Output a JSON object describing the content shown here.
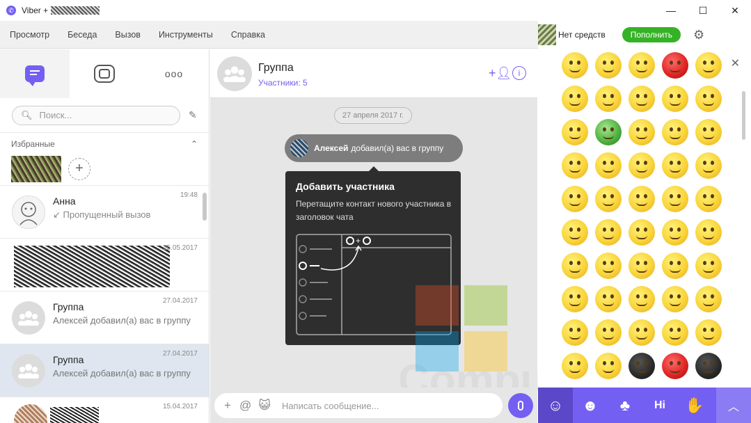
{
  "window": {
    "title": "Viber +",
    "controls": {
      "minimize": "—",
      "maximize": "☐",
      "close": "✕"
    }
  },
  "menu": {
    "items": [
      "Просмотр",
      "Беседа",
      "Вызов",
      "Инструменты",
      "Справка"
    ],
    "balance": "Нет средств",
    "topup_label": "Пополнить",
    "settings_icon": "gear-icon"
  },
  "left": {
    "search_placeholder": "Поиск...",
    "favorites_label": "Избранные",
    "chats": [
      {
        "name": "Анна",
        "message": "↙ Пропущенный вызов",
        "time": "19:48"
      },
      {
        "name": "",
        "message": "",
        "time": "25.05.2017"
      },
      {
        "name": "Группа",
        "message": "Алексей добавил(а) вас в группу",
        "time": "27.04.2017"
      },
      {
        "name": "Группа",
        "message": "Алексей добавил(а) вас в группу",
        "time": "27.04.2017"
      },
      {
        "name": "",
        "message": "",
        "time": "15.04.2017"
      }
    ]
  },
  "conversation": {
    "name": "Группа",
    "subtitle": "Участники: 5",
    "date": "27 апреля 2017 г.",
    "system_actor": "Алексей",
    "system_text": "добавил(а) вас в группу",
    "tip_title": "Добавить участника",
    "tip_text": "Перетащите контакт нового участника в заголовок чата",
    "input_placeholder": "Написать сообщение..."
  },
  "emoji_panel": {
    "close": "✕",
    "tabs": [
      "smiley-icon",
      "character-icon",
      "creature-icon",
      "hi-icon",
      "hand-icon",
      "collapse-icon"
    ],
    "hi_label": "Hi"
  },
  "watermark": "Computer-Setup.Ru",
  "colors": {
    "accent": "#7360f2",
    "topup": "#36b226",
    "selected_row": "#dfe6ef"
  }
}
